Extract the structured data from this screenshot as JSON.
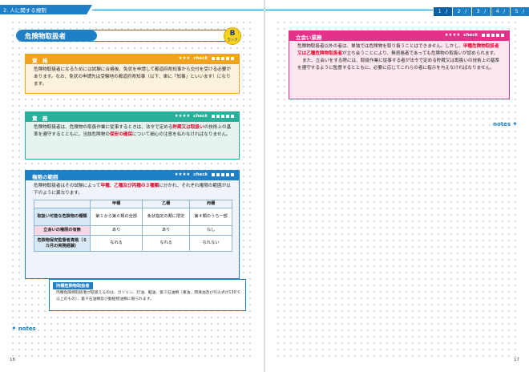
{
  "header": {
    "chapter": "2. 人に関する規制",
    "tabs": [
      "1",
      "2",
      "3",
      "4",
      "5"
    ]
  },
  "left": {
    "title": "危険物取扱者",
    "badge": {
      "letter": "B",
      "sub": "ランク"
    },
    "qualification": {
      "label": "資　格",
      "stars": "★★★",
      "check": "check",
      "text": "危険物取扱者になるためには試験に合格後、免状を申請して都道府県知事から交付を受ける必要があります。なお、免状の申請先は受験地の都道府県知事（以下、単に「知事」といいます）になります。"
    },
    "duty": {
      "label": "責　務",
      "stars": "★★★★",
      "check": "check",
      "text1": "危険物取扱者は、危険物の取扱作業に従事するときは、法令で定める",
      "red1": "貯蔵又は取扱い",
      "text2": "の技術上の基準を遵守するとともに、当該危険物の",
      "red2": "保安の確保",
      "text3": "について細心の注意を払わなければなりません。"
    },
    "scope": {
      "label": "権限の範囲",
      "stars": "★★★★",
      "check": "check",
      "text1": "危険物取扱者はその試験によって",
      "red1": "甲種、乙種及び丙種の３種類",
      "text2": "に分かれ、それぞれ権限の範囲が以下のように異なります。",
      "table": {
        "headers": [
          "",
          "甲種",
          "乙種",
          "丙種"
        ],
        "rows": [
          [
            "取扱い可能な危険物の種類",
            "第１から第６類の全部",
            "免状指定の類に限定",
            "第４類のうち一部"
          ],
          [
            "立会いの権限の有無",
            "あり",
            "あり",
            "なし"
          ],
          [
            "危険物保安監督者資格（６カ月の実務経験）",
            "なれる",
            "なれる",
            "なれない"
          ]
        ]
      }
    },
    "sub": {
      "title": "丙種危険物取扱者",
      "text": "丙種危険物取扱者が取扱えるのは、ガソリン、灯油、軽油、第３石油類（重油、潤滑油及び引火点が130℃以上のもの）、第４石油類及び動植物油類に限られます。"
    },
    "notes": "notes",
    "page": "16"
  },
  "right": {
    "witness": {
      "label": "立会い業務",
      "stars": "★★★★",
      "check": "check",
      "text1": "危険物取扱者以外の者は、単独では危険物を取り扱うことはできません。しかし、",
      "red1": "甲種危険物取扱者又は乙種危険物取扱者",
      "text2": "が立ち会うことにより、無資格者であっても危険物の取扱いが認められます。",
      "text3": "また、立会いをする際には、取扱作業に従事する者が法令で定める貯蔵又は取扱いの技術上の基準を遵守するように監督するとともに、必要に応じてこれらの者に指示を与えなければなりません。"
    },
    "notes": "notes",
    "page": "17"
  }
}
